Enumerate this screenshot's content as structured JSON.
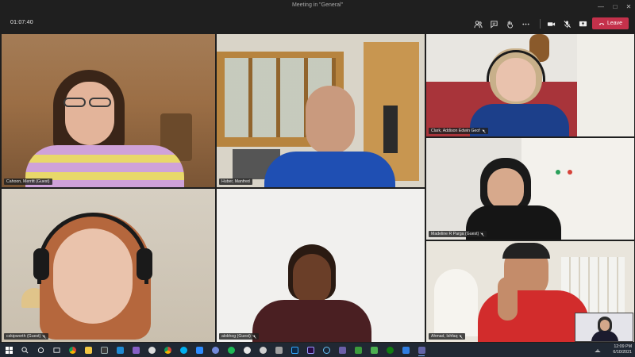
{
  "window": {
    "title": "Meeting in \"General\""
  },
  "toolbar": {
    "timer": "01:07:40",
    "icons": [
      "people-icon",
      "chat-icon",
      "raise-hand-icon",
      "more-icon",
      "camera-icon",
      "mic-muted-icon",
      "share-screen-icon"
    ],
    "leave_label": "Leave",
    "leave_color": "#c4314b"
  },
  "participants": [
    {
      "name": "Cahoon, Merritt (Guest)",
      "muted": false
    },
    {
      "name": "Huber, Manfred",
      "muted": false
    },
    {
      "name": "Clark, Addison Edwin Geof",
      "muted": true
    },
    {
      "name": "Madeline R Parga (Guest)",
      "muted": true
    },
    {
      "name": "cskipworth (Guest)",
      "muted": true
    },
    {
      "name": "alokhog (Guest)",
      "muted": true
    },
    {
      "name": "Ahmad, Ishfaq",
      "muted": true
    }
  ],
  "taskbar": {
    "time": "12:09 PM",
    "date": "6/10/2021",
    "apps": [
      "windows-start-icon",
      "search-icon",
      "cortana-icon",
      "task-view-icon",
      "chrome-icon",
      "file-explorer-icon",
      "app-icon",
      "vscode-icon",
      "visual-studio-icon",
      "discord-icon",
      "chrome-icon",
      "skype-icon",
      "zoom-icon",
      "discord-icon",
      "spotify-icon",
      "app-icon",
      "github-icon",
      "app-icon",
      "photoshop-icon",
      "premiere-icon",
      "steam-icon",
      "app-icon",
      "app-icon",
      "app-icon",
      "xbox-icon",
      "app-icon",
      "teams-icon"
    ]
  }
}
